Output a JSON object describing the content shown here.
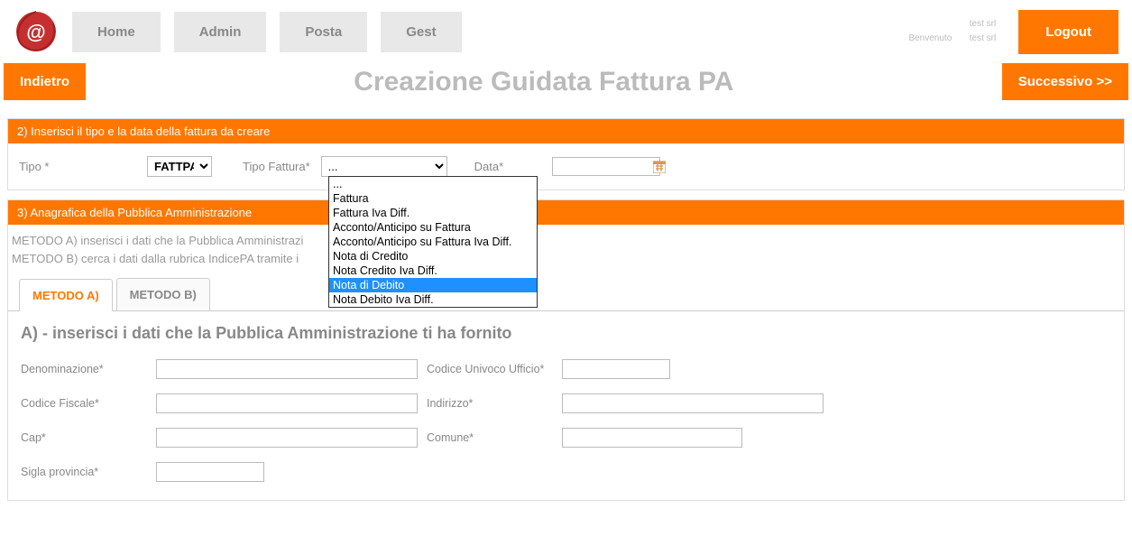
{
  "nav": {
    "home": "Home",
    "admin": "Admin",
    "posta": "Posta",
    "gest": "Gest"
  },
  "user": {
    "line1": "test srl",
    "line2a": "Benvenuto",
    "line2b": "test srl"
  },
  "logout": "Logout",
  "back": "Indietro",
  "next": "Successivo >>",
  "title": "Creazione Guidata Fattura PA",
  "panel2": {
    "header": "2) Inserisci il tipo e la data della fattura da creare",
    "tipo_label": "Tipo *",
    "tipo_value": "FATTPA",
    "tipofat_label": "Tipo Fattura*",
    "tipofat_value": "...",
    "data_label": "Data*",
    "data_value": "",
    "options": [
      "...",
      "Fattura",
      "Fattura Iva Diff.",
      "Acconto/Anticipo su Fattura",
      "Acconto/Anticipo su Fattura Iva Diff.",
      "Nota di Credito",
      "Nota Credito Iva Diff.",
      "Nota di Debito",
      "Nota Debito Iva Diff."
    ],
    "highlight_index": 7
  },
  "panel3": {
    "header": "3) Anagrafica della Pubblica Amministrazione",
    "desc_a": "METODO A) inserisci i dati che la Pubblica Amministrazi",
    "desc_b": "METODO B) cerca i dati dalla rubrica IndicePA tramite i",
    "tab_a": "METODO A)",
    "tab_b": "METODO B)",
    "heading": "A) - inserisci i dati che la Pubblica Amministrazione ti ha fornito",
    "fields": {
      "denom": "Denominazione*",
      "codun": "Codice Univoco Ufficio*",
      "codfisc": "Codice Fiscale*",
      "indir": "Indirizzo*",
      "cap": "Cap*",
      "comune": "Comune*",
      "sigla": "Sigla provincia*"
    }
  }
}
